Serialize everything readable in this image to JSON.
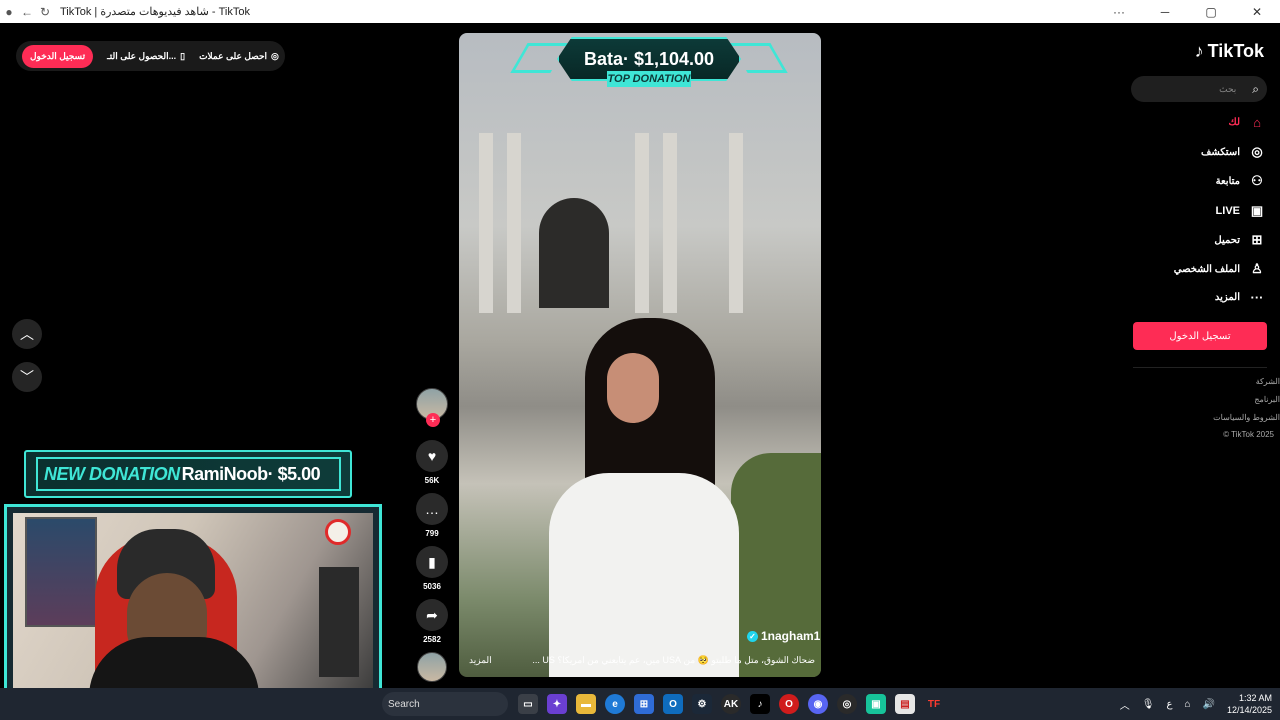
{
  "window": {
    "title": "TikTok | شاهد فيديوهات متصدرة - TikTok"
  },
  "topbar": {
    "login_label": "تسجيل الدخول",
    "get_app_label": "الحصول على التـ...",
    "get_coins_label": "احصل على عملات"
  },
  "stream_overlay": {
    "new_donation_label": "NEW DONATION",
    "new_donation_text": "RamiNoob· $5.00",
    "top_donation_amount": "Bata· $1,104.00",
    "top_donation_label": "TOP DONATION"
  },
  "video": {
    "author": "1nagham1",
    "caption": "ضحاك الشوق، متل ما طلبتو 🥺 من USA ميں، عم يتابعني من امريكا؟ US ...",
    "more_label": "المزيد"
  },
  "actions": {
    "likes": "56K",
    "comments": "799",
    "saves": "5036",
    "shares": "2582"
  },
  "sidebar": {
    "logo": "TikTok",
    "search_placeholder": "بحث",
    "items": [
      {
        "label": "لك",
        "icon": "home-icon"
      },
      {
        "label": "استكشف",
        "icon": "compass-icon"
      },
      {
        "label": "متابعة",
        "icon": "following-icon"
      },
      {
        "label": "LIVE",
        "icon": "live-icon"
      },
      {
        "label": "تحميل",
        "icon": "upload-icon"
      },
      {
        "label": "الملف الشخصي",
        "icon": "profile-icon"
      },
      {
        "label": "المزيد",
        "icon": "more-icon"
      }
    ],
    "login_button": "تسجيل الدخول",
    "footer": [
      "الشركة",
      "البرنامج",
      "الشروط والسياسات",
      "© TikTok 2025"
    ]
  },
  "taskbar": {
    "search_label": "Search",
    "lang": "ع",
    "time": "1:32 AM",
    "date": "12/14/2025"
  },
  "colors": {
    "accent": "#fe2c55",
    "overlay": "#3fe6d6"
  }
}
